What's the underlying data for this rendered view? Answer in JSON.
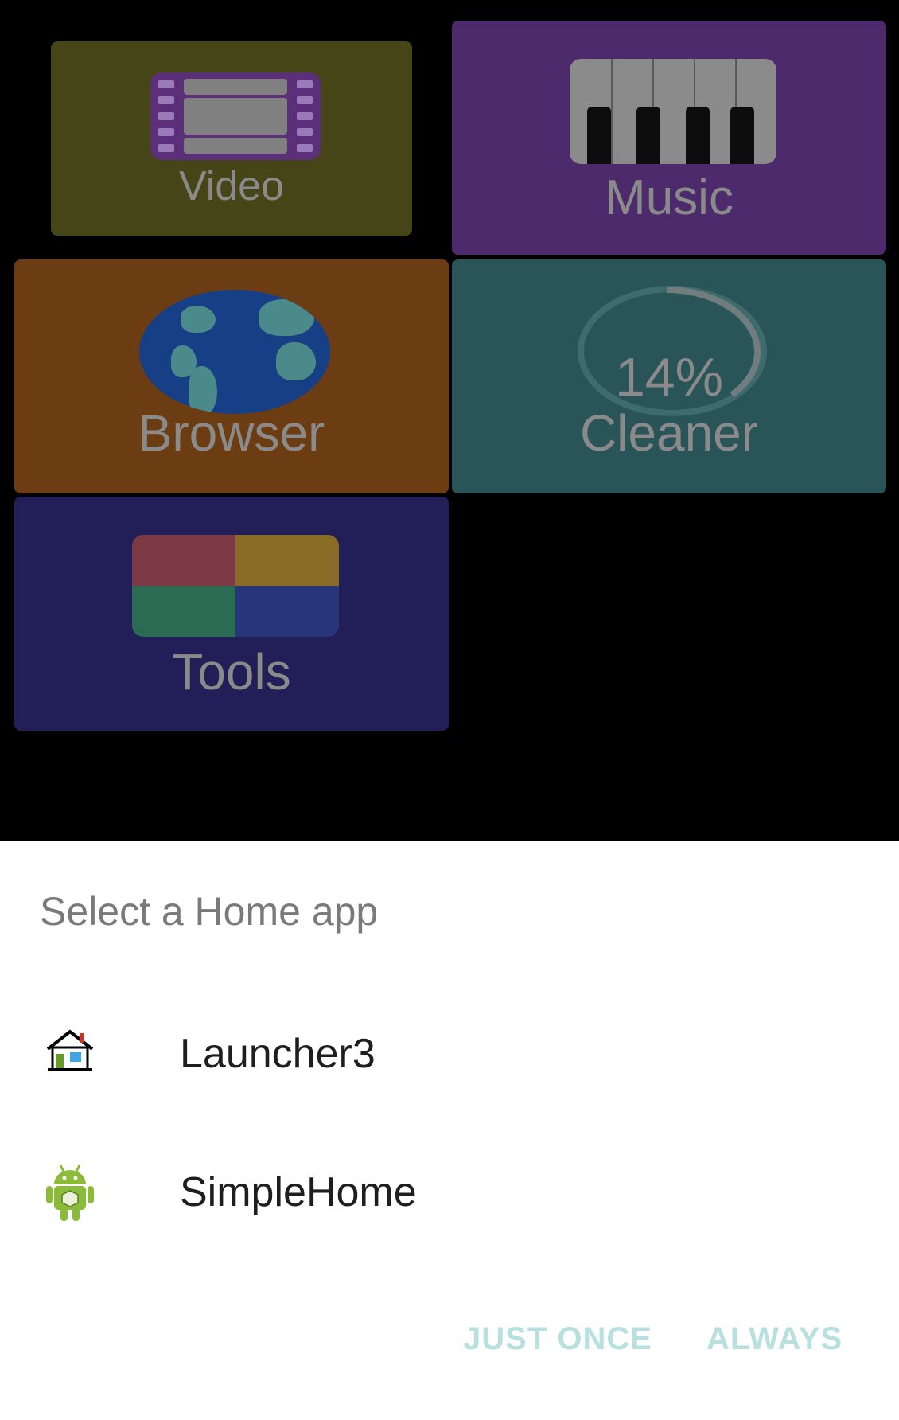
{
  "launcher": {
    "tiles": [
      {
        "label": "Video",
        "color": "#454517"
      },
      {
        "label": "Music",
        "color": "#4c2a6b"
      },
      {
        "label": "Browser",
        "color": "#6c3d12"
      },
      {
        "label": "Cleaner",
        "color": "#2a5558"
      },
      {
        "label": "Tools",
        "color": "#221e57"
      }
    ],
    "cleaner_percent": "14%"
  },
  "dialog": {
    "title": "Select a Home app",
    "options": [
      {
        "label": "Launcher3",
        "icon": "house-icon"
      },
      {
        "label": "SimpleHome",
        "icon": "android-icon"
      }
    ],
    "buttons": {
      "just_once": "JUST ONCE",
      "always": "ALWAYS"
    },
    "button_color": "#b8e0df"
  }
}
